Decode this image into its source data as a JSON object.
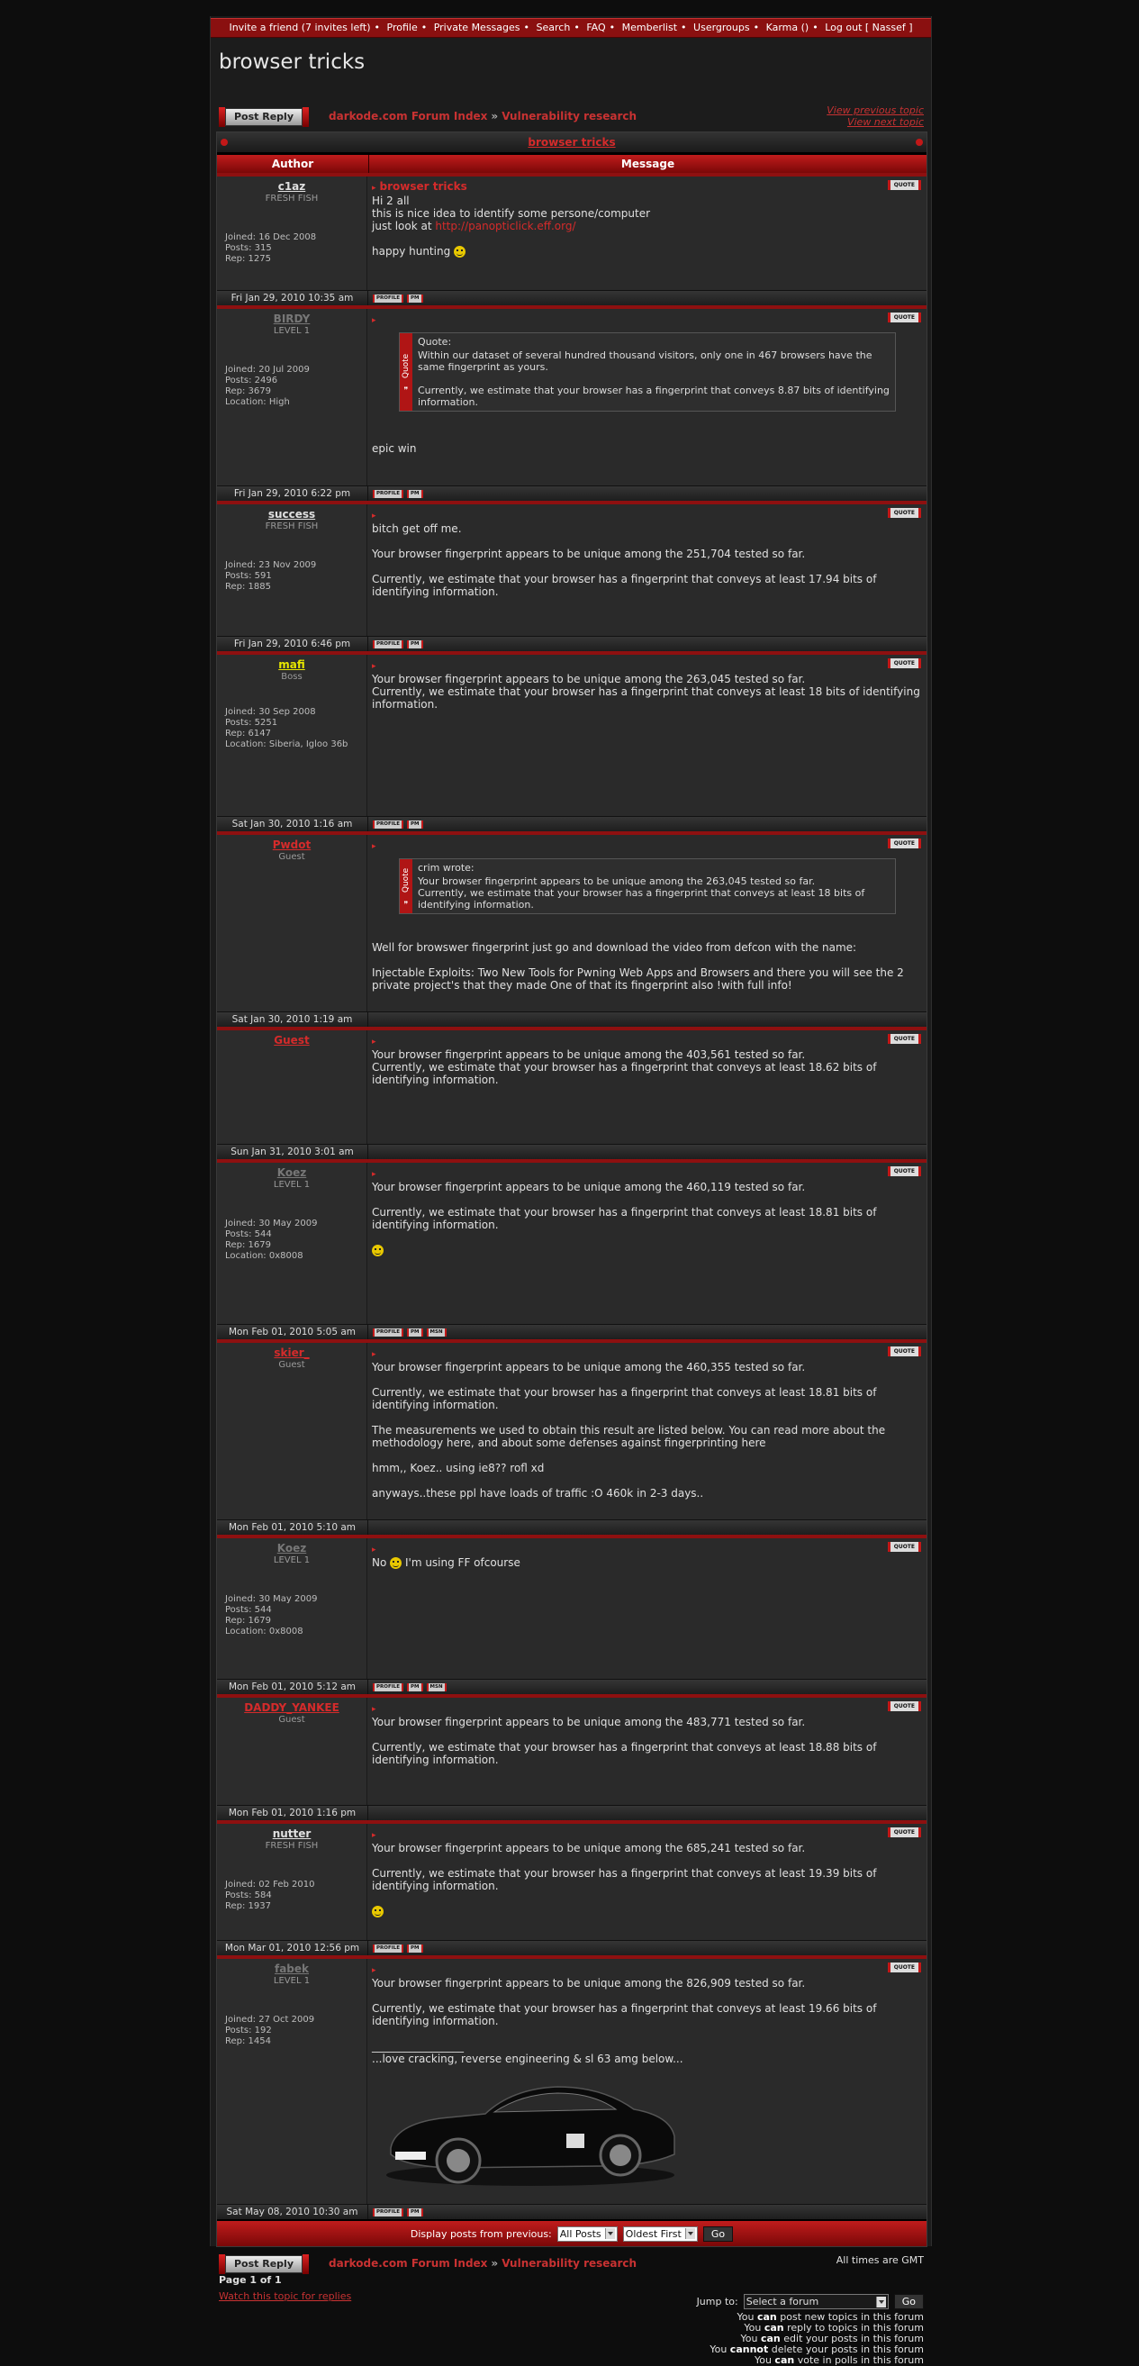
{
  "topnav": [
    "Invite a friend (7 invites left)",
    "Profile",
    "Private Messages",
    "Search",
    "FAQ",
    "Memberlist",
    "Usergroups",
    "Karma ()",
    "Log out [ Nassef ]"
  ],
  "page_title": "browser tricks",
  "post_reply_label": "Post Reply",
  "breadcrumb": {
    "home": "darkode.com Forum Index",
    "sep": "»",
    "forum": "Vulnerability research"
  },
  "nav": {
    "prev": "View previous topic",
    "next": "View next topic"
  },
  "topic_title": "browser tricks",
  "table_headers": {
    "author": "Author",
    "message": "Message"
  },
  "button_labels": {
    "quote": "QUOTE",
    "profile": "PROFILE",
    "pm": "PM",
    "msn": "MSN"
  },
  "posts": [
    {
      "author": "c1az",
      "title": "FRESH FISH",
      "name_color": "#e0e0e0",
      "stats": [
        "Joined: 16 Dec 2008",
        "Posts: 315",
        "Rep: 1275"
      ],
      "subject": "browser tricks",
      "lines": [
        "Hi 2 all",
        "",
        "this is nice idea to identify some persone/computer"
      ],
      "link_prefix": "just look at ",
      "link": "http://panopticlick.eff.org/",
      "tail": "happy hunting",
      "date": "Fri Jan 29, 2010 10:35 am"
    },
    {
      "author": "BIRDY",
      "title": "LEVEL 1",
      "name_color": "#777",
      "stats": [
        "Joined: 20 Jul 2009",
        "Posts: 2496",
        "Rep: 3679",
        "Location: High"
      ],
      "quote_head": "Quote:",
      "quote_text": "Within our dataset of several hundred thousand visitors, only one in 467 browsers have the same fingerprint as yours.\n\nCurrently, we estimate that your browser has a fingerprint that conveys 8.87 bits of identifying information.",
      "after": "epic win",
      "date": "Fri Jan 29, 2010 6:22 pm"
    },
    {
      "author": "success",
      "title": "FRESH FISH",
      "name_color": "#e0e0e0",
      "stats": [
        "Joined: 23 Nov 2009",
        "Posts: 591",
        "Rep: 1885"
      ],
      "text": "bitch get off me.\n\nYour browser fingerprint appears to be unique among the 251,704 tested so far.\n\nCurrently, we estimate that your browser has a fingerprint that conveys at least 17.94 bits of identifying information.",
      "date": "Fri Jan 29, 2010 6:46 pm"
    },
    {
      "author": "mafi",
      "title": "Boss",
      "name_color": "#e6e600",
      "stats": [
        "Joined: 30 Sep 2008",
        "Posts: 5251",
        "Rep: 6147",
        "Location: Siberia, Igloo 36b"
      ],
      "text": "Your browser fingerprint appears to be unique among the 263,045 tested so far.\nCurrently, we estimate that your browser has a fingerprint that conveys at least 18 bits of identifying information.",
      "date": "Sat Jan 30, 2010 1:16 am"
    },
    {
      "author": "Pwdot",
      "title": "Guest",
      "name_color": "#d52b2b",
      "quote_head": "crim wrote:",
      "quote_text": "Your browser fingerprint appears to be unique among the 263,045 tested so far.\nCurrently, we estimate that your browser has a fingerprint that conveys at least 18 bits of identifying information.",
      "after": "Well for browswer fingerprint just go and download the video from defcon with the name:\n\nInjectable Exploits: Two New Tools for Pwning Web Apps and Browsers and there you will see the 2 private project's that they made One of that its fingerprint also !with full info!",
      "date": "Sat Jan 30, 2010 1:19 am"
    },
    {
      "author": "Guest",
      "title": "",
      "name_color": "#d52b2b",
      "text": "Your browser fingerprint appears to be unique among the 403,561 tested so far.\nCurrently, we estimate that your browser has a fingerprint that conveys at least 18.62 bits of identifying information.",
      "date": "Sun Jan 31, 2010 3:01 am"
    },
    {
      "author": "Koez",
      "title": "LEVEL 1",
      "name_color": "#777",
      "stats": [
        "Joined: 30 May 2009",
        "Posts: 544",
        "Rep: 1679",
        "Location: 0x8008"
      ],
      "text": "Your browser fingerprint appears to be unique among the 460,119 tested so far.\n\nCurrently, we estimate that your browser has a fingerprint that conveys at least 18.81 bits of identifying information.",
      "date": "Mon Feb 01, 2010 5:05 am"
    },
    {
      "author": "skier_",
      "title": "Guest",
      "name_color": "#d52b2b",
      "text": "Your browser fingerprint appears to be unique among the 460,355 tested so far.\n\nCurrently, we estimate that your browser has a fingerprint that conveys at least 18.81 bits of identifying information.\n\nThe measurements we used to obtain this result are listed below. You can read more about the methodology here, and about some defenses against fingerprinting here\n\nhmm,, Koez.. using ie8?? rofl xd\n\nanyways..these ppl have loads of traffic :O 460k in 2-3 days..",
      "date": "Mon Feb 01, 2010 5:10 am"
    },
    {
      "author": "Koez",
      "title": "LEVEL 1",
      "name_color": "#777",
      "stats": [
        "Joined: 30 May 2009",
        "Posts: 544",
        "Rep: 1679",
        "Location: 0x8008"
      ],
      "pre": "No",
      "text": "I'm using FF ofcourse",
      "date": "Mon Feb 01, 2010 5:12 am"
    },
    {
      "author": "DADDY_YANKEE",
      "title": "Guest",
      "name_color": "#d52b2b",
      "text": "Your browser fingerprint appears to be unique among the 483,771 tested so far.\n\nCurrently, we estimate that your browser has a fingerprint that conveys at least 18.88 bits of identifying information.",
      "date": "Mon Feb 01, 2010 1:16 pm"
    },
    {
      "author": "nutter",
      "title": "FRESH FISH",
      "name_color": "#e0e0e0",
      "stats": [
        "Joined: 02 Feb 2010",
        "Posts: 584",
        "Rep: 1937"
      ],
      "text": "Your browser fingerprint appears to be unique among the 685,241 tested so far.\n\nCurrently, we estimate that your browser has a fingerprint that conveys at least 19.39 bits of identifying information.",
      "date": "Mon Mar 01, 2010 12:56 pm"
    },
    {
      "author": "fabek",
      "title": "LEVEL 1",
      "name_color": "#777",
      "stats": [
        "Joined: 27 Oct 2009",
        "Posts: 192",
        "Rep: 1454"
      ],
      "text": "Your browser fingerprint appears to be unique among the 826,909 tested so far.\n\nCurrently, we estimate that your browser has a fingerprint that conveys at least 19.66 bits of identifying information.",
      "signature": "_________________\n...love cracking, reverse engineering & sl 63 amg below...",
      "date": "Sat May 08, 2010 10:30 am"
    }
  ],
  "display_label": "Display posts from previous:",
  "display_value": "All Posts",
  "order_value": "Oldest First",
  "go_label": "Go",
  "timezone": "All times are GMT",
  "pagination": "Page 1 of 1",
  "watch": "Watch this topic for replies",
  "jump_label": "Jump to:",
  "jump_value": "Select a forum",
  "permissions": [
    [
      "You ",
      "can",
      " post new topics in this forum"
    ],
    [
      "You ",
      "can",
      " reply to topics in this forum"
    ],
    [
      "You ",
      "can",
      " edit your posts in this forum"
    ],
    [
      "You ",
      "cannot",
      " delete your posts in this forum"
    ],
    [
      "You ",
      "can",
      " vote in polls in this forum"
    ]
  ]
}
